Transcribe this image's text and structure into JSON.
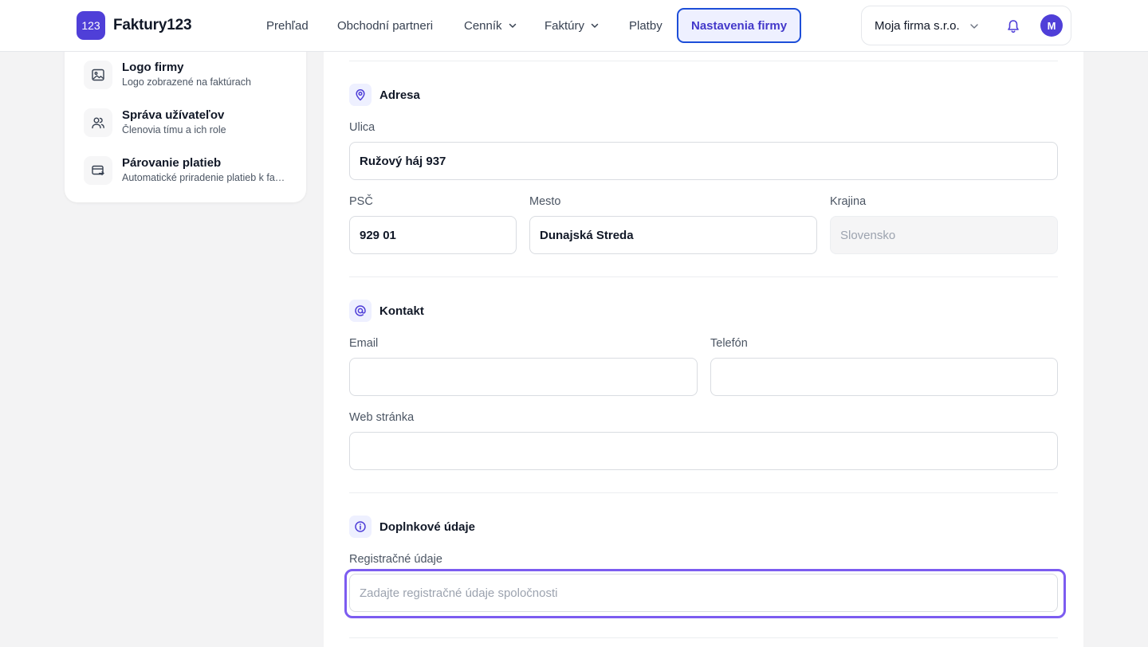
{
  "header": {
    "logo_text": "123",
    "brand": "Faktury123",
    "nav": [
      {
        "label": "Prehľad"
      },
      {
        "label": "Obchodní partneri"
      },
      {
        "label": "Cenník"
      },
      {
        "label": "Faktúry"
      },
      {
        "label": "Platby"
      },
      {
        "label": "Nastavenia firmy"
      }
    ],
    "account": {
      "firm_name": "Moja firma s.r.o.",
      "avatar_initial": "M"
    }
  },
  "sidebar": {
    "items": [
      {
        "title": "Logo firmy",
        "subtitle": "Logo zobrazené na faktúrach",
        "icon": "image-icon"
      },
      {
        "title": "Správa užívateľov",
        "subtitle": "Členovia tímu a ich role",
        "icon": "users-icon"
      },
      {
        "title": "Párovanie platieb",
        "subtitle": "Automatické priradenie platieb k faktúram",
        "icon": "payment-match-icon"
      }
    ]
  },
  "address": {
    "title": "Adresa",
    "street_label": "Ulica",
    "street_value": "Ružový háj 937",
    "zip_label": "PSČ",
    "zip_value": "929 01",
    "city_label": "Mesto",
    "city_value": "Dunajská Streda",
    "country_label": "Krajina",
    "country_value": "Slovensko"
  },
  "contact": {
    "title": "Kontakt",
    "email_label": "Email",
    "email_value": "",
    "phone_label": "Telefón",
    "phone_value": "",
    "web_label": "Web stránka",
    "web_value": ""
  },
  "extra": {
    "title": "Doplnkové údaje",
    "registration_label": "Registračné údaje",
    "registration_placeholder": "Zadajte registračné údaje spoločnosti"
  },
  "colors": {
    "accent": "#4f3fd8",
    "active_nav_border": "#1d4ed8",
    "focus_ring": "#7c5cf0"
  }
}
